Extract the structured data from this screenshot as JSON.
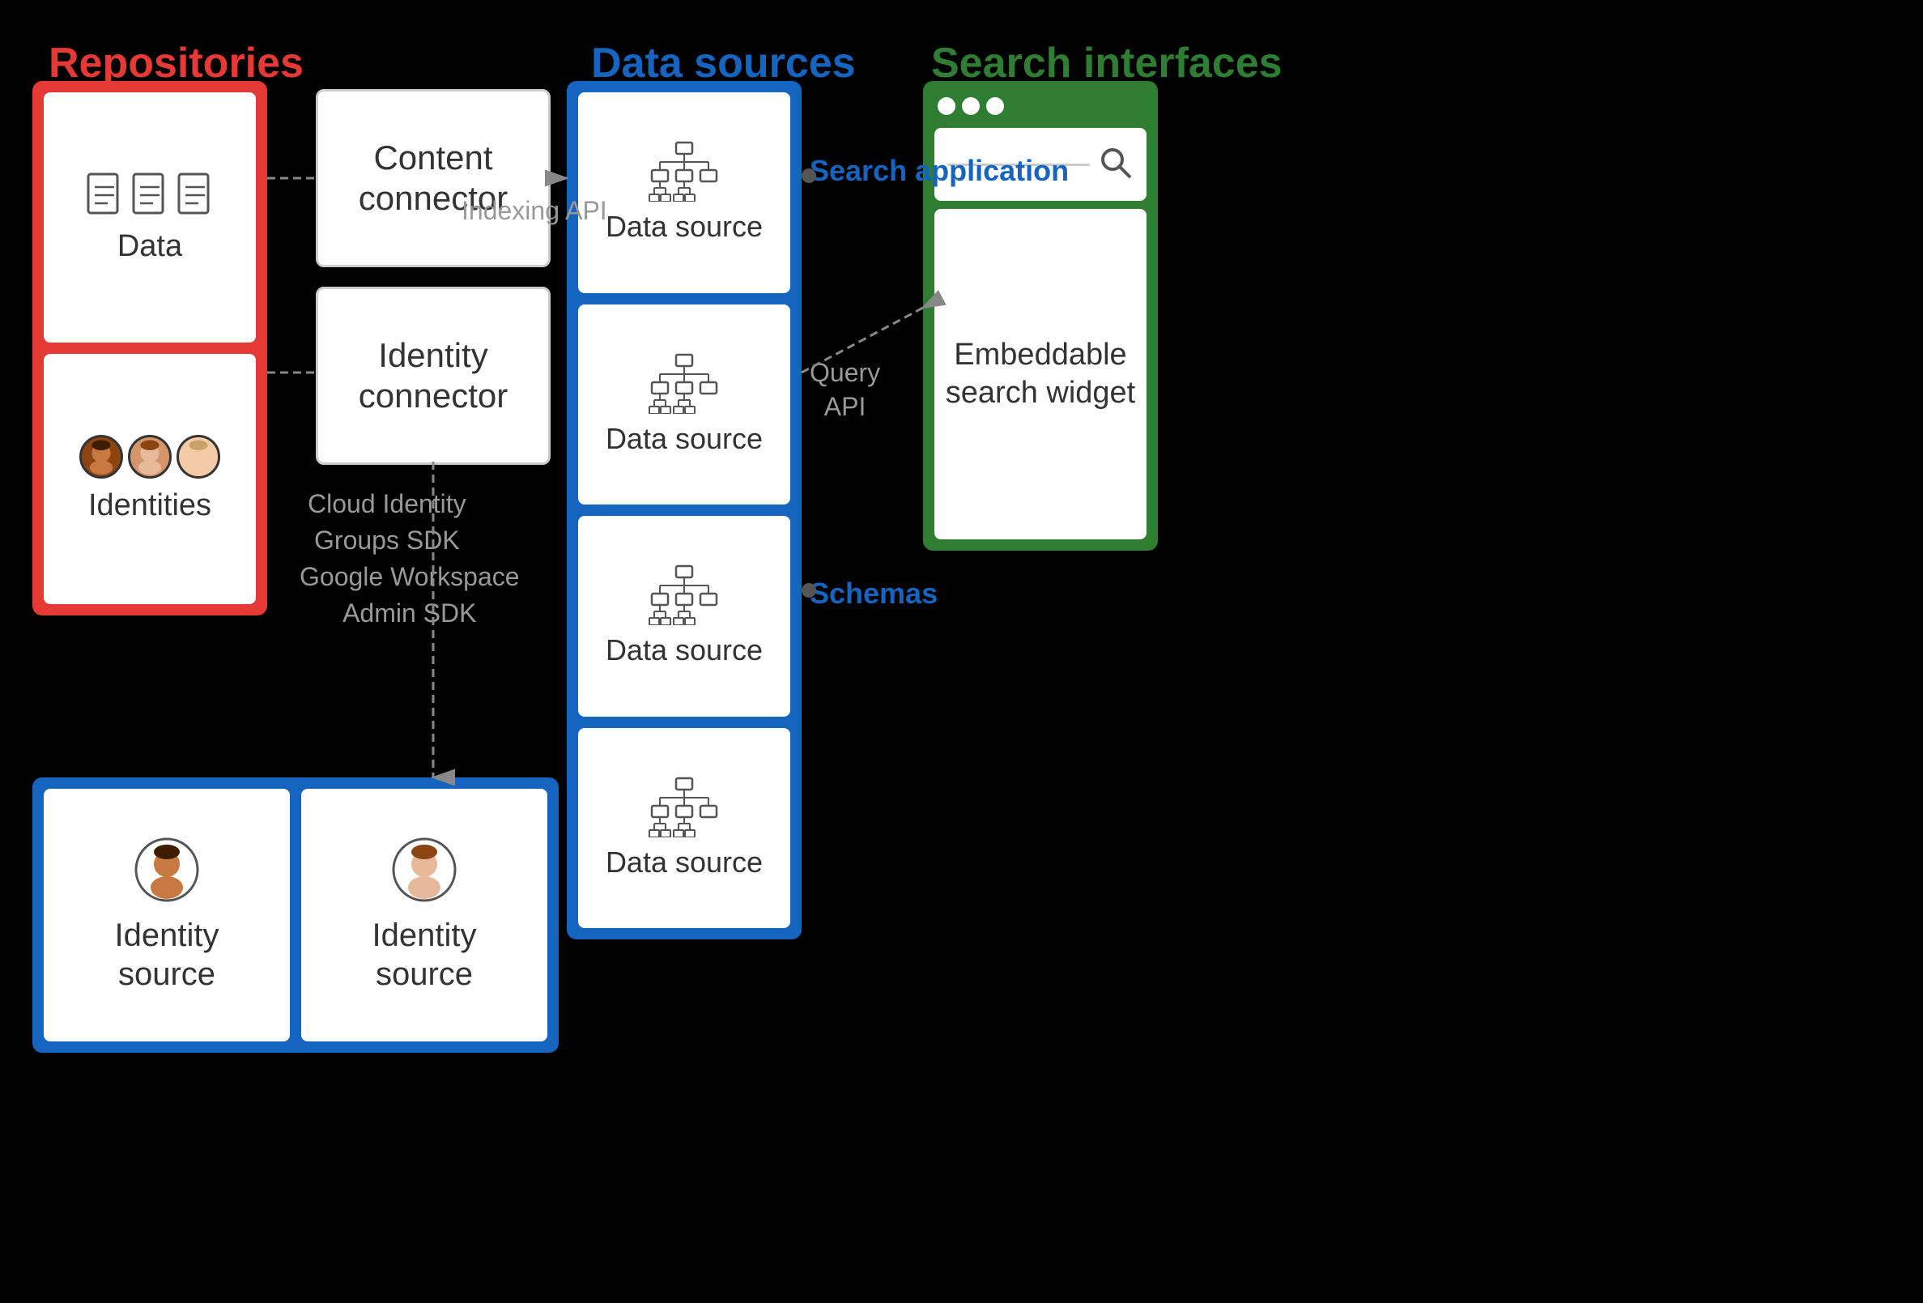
{
  "sections": {
    "repositories": {
      "label": "Repositories",
      "color": "#e53935",
      "items": [
        {
          "icon_type": "data",
          "label": "Data"
        },
        {
          "icon_type": "identities",
          "label": "Identities"
        }
      ]
    },
    "connectors": {
      "items": [
        {
          "label": "Content\nconnector"
        },
        {
          "label": "Identity\nconnector"
        }
      ]
    },
    "datasources": {
      "label": "Data sources",
      "color": "#1565c0",
      "items": [
        {
          "label": "Data source"
        },
        {
          "label": "Data source"
        },
        {
          "label": "Data source"
        },
        {
          "label": "Data source"
        }
      ]
    },
    "search_interfaces": {
      "label": "Search interfaces",
      "color": "#2e7d32",
      "widget_label": "Embeddable\nsearch\nwidget"
    },
    "identity_sources": {
      "items": [
        {
          "icon": "face1",
          "label": "Identity\nsource"
        },
        {
          "icon": "face2",
          "label": "Identity\nsource"
        }
      ]
    }
  },
  "api_labels": {
    "indexing_api": "Indexing API",
    "cloud_identity": "Cloud Identity\nGroups SDK",
    "google_workspace": "Google Workspace\nAdmin SDK",
    "query_api": "Query\nAPI"
  },
  "blue_labels": {
    "search_application": "Search\napplication",
    "schemas": "Schemas"
  }
}
